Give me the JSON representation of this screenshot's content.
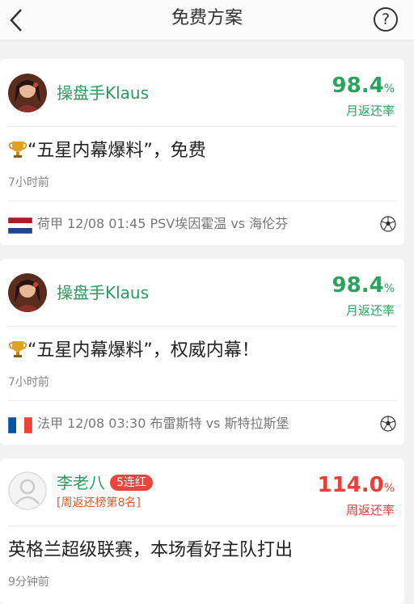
{
  "header": {
    "title": "免费方案",
    "help_icon": "?"
  },
  "cards": [
    {
      "user": "操盘手Klaus",
      "rate_value": "98.4",
      "rate_unit": "%",
      "rate_label": "月返还率",
      "headline": "“五星内幕爆料”，免费",
      "time": "7小时前",
      "match": "荷甲 12/08 01:45 PSV埃因霍温 vs 海伦芬",
      "flag": "netherlands"
    },
    {
      "user": "操盘手Klaus",
      "rate_value": "98.4",
      "rate_unit": "%",
      "rate_label": "月返还率",
      "headline": "“五星内幕爆料”，权威内幕！",
      "time": "7小时前",
      "match": "法甲 12/08 03:30 布雷斯特 vs 斯特拉斯堡",
      "flag": "france"
    },
    {
      "user": "李老八",
      "streak": "5连红",
      "rank": "[周返还榜第8名]",
      "rate_value": "114.0",
      "rate_unit": "%",
      "rate_label": "周返还率",
      "headline": "英格兰超级联赛，本场看好主队打出",
      "time": "9分钟前"
    }
  ],
  "colors": {
    "green": "#2ba35e",
    "red": "#e5403a"
  }
}
